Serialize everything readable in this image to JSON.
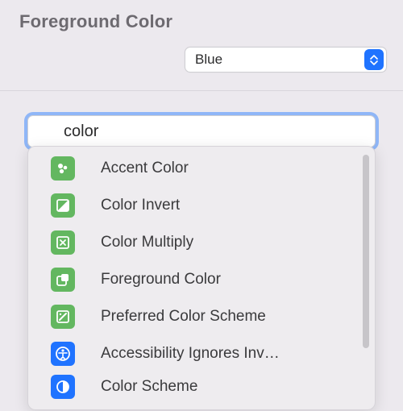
{
  "section_title": "Foreground Color",
  "select": {
    "value": "Blue"
  },
  "search": {
    "value": "color"
  },
  "results": [
    {
      "icon": "accent-color-icon",
      "iconColor": "green",
      "label": "Accent Color"
    },
    {
      "icon": "color-invert-icon",
      "iconColor": "green",
      "label": "Color Invert"
    },
    {
      "icon": "color-multiply-icon",
      "iconColor": "green",
      "label": "Color Multiply"
    },
    {
      "icon": "foreground-color-icon",
      "iconColor": "green",
      "label": "Foreground Color"
    },
    {
      "icon": "preferred-color-scheme-icon",
      "iconColor": "green",
      "label": "Preferred Color Scheme"
    },
    {
      "icon": "accessibility-icon",
      "iconColor": "blue",
      "label": "Accessibility Ignores Inv…"
    },
    {
      "icon": "color-scheme-icon",
      "iconColor": "blue",
      "label": "Color Scheme"
    }
  ]
}
